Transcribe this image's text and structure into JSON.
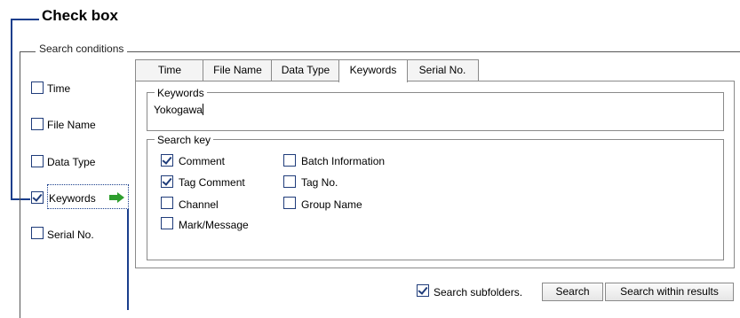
{
  "annotation": {
    "title": "Check box"
  },
  "group": {
    "label": "Search conditions"
  },
  "conditions": [
    {
      "label": "Time",
      "checked": false
    },
    {
      "label": "File Name",
      "checked": false
    },
    {
      "label": "Data Type",
      "checked": false
    },
    {
      "label": "Keywords",
      "checked": true
    },
    {
      "label": "Serial No.",
      "checked": false
    }
  ],
  "tabs": [
    {
      "label": "Time"
    },
    {
      "label": "File Name"
    },
    {
      "label": "Data Type"
    },
    {
      "label": "Keywords",
      "active": true
    },
    {
      "label": "Serial No."
    }
  ],
  "keywords": {
    "legend": "Keywords",
    "value": "Yokogawa"
  },
  "search_key": {
    "legend": "Search key",
    "options": [
      {
        "label": "Comment",
        "checked": true
      },
      {
        "label": "Tag Comment",
        "checked": true
      },
      {
        "label": "Channel",
        "checked": false
      },
      {
        "label": "Mark/Message",
        "checked": false
      },
      {
        "label": "Batch Information",
        "checked": false
      },
      {
        "label": "Tag No.",
        "checked": false
      },
      {
        "label": "Group Name",
        "checked": false
      }
    ]
  },
  "footer": {
    "subfolders_label": "Search subfolders.",
    "subfolders_checked": true,
    "search_button": "Search",
    "search_within_button": "Search within results"
  },
  "colors": {
    "annotation_line": "#1a3e8c",
    "arrow": "#2e9e2e",
    "checkbox_border": "#1f3c7a"
  },
  "icons": {
    "arrow": "green-right-arrow-icon"
  }
}
